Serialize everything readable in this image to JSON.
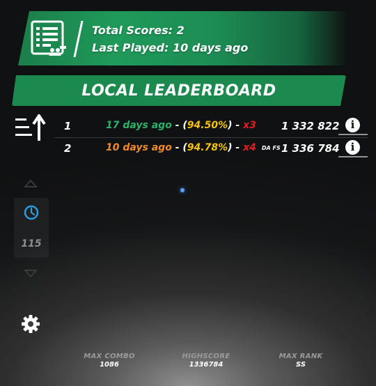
{
  "stats": {
    "total_scores": "Total Scores: 2",
    "last_played": "Last Played: 10 days ago",
    "icon": "scoreboard-document-icon"
  },
  "title": "LOCAL LEADERBOARD",
  "sort_icon": "sort-ascending-icon",
  "rows": [
    {
      "rank": "1",
      "date": "17 days ago",
      "date_color": "#2bb36b",
      "sep1": " - (",
      "accuracy": "94.50%",
      "sep2": ") - ",
      "misses": "x3",
      "mods": "",
      "score": "1 332 822"
    },
    {
      "rank": "2",
      "date": "10 days ago",
      "date_color": "#f08a2b",
      "sep1": " - (",
      "accuracy": "94.78%",
      "sep2": ") - ",
      "misses": "x4",
      "mods": "DA FS",
      "score": "1 336 784"
    }
  ],
  "info_label": "i",
  "pagination": {
    "count": "115",
    "up_icon": "triangle-up-icon",
    "down_icon": "triangle-down-icon",
    "clock_icon": "clock-icon"
  },
  "settings_icon": "gear-icon",
  "footer": [
    {
      "label": "MAX COMBO",
      "value": "1086"
    },
    {
      "label": "HIGHSCORE",
      "value": "1336784"
    },
    {
      "label": "MAX RANK",
      "value": "SS"
    }
  ],
  "colors": {
    "accent_green": "#1c8a4e",
    "accuracy_yellow": "#f5c400",
    "miss_red": "#e01f1f",
    "clock_blue": "#2b9be0"
  }
}
